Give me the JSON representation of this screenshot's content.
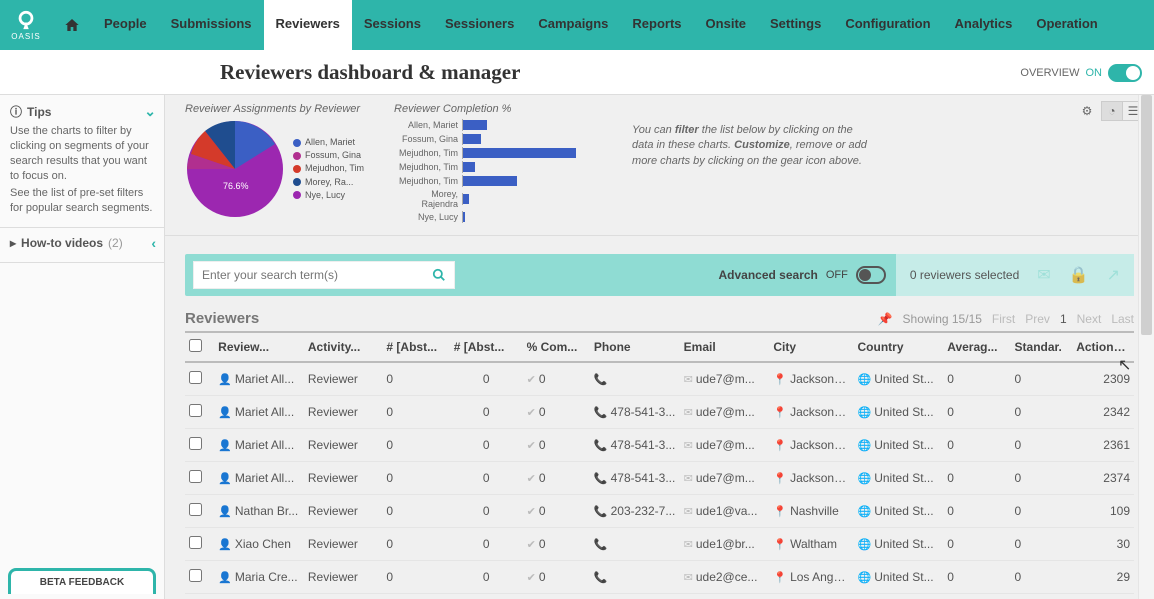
{
  "brand": "OASIS",
  "nav": [
    "People",
    "Submissions",
    "Reviewers",
    "Sessions",
    "Sessioners",
    "Campaigns",
    "Reports",
    "Onsite",
    "Settings",
    "Configuration",
    "Analytics",
    "Operation"
  ],
  "nav_active": "Reviewers",
  "page_title": "Reviewers dashboard & manager",
  "overview": {
    "label": "OVERVIEW",
    "state": "ON"
  },
  "tips": {
    "title": "Tips",
    "body1": "Use the charts to filter by clicking on segments of your search results that you want to focus on.",
    "body2": "See the list of pre-set filters for popular search segments."
  },
  "howto": {
    "title": "How-to videos",
    "count": "(2)"
  },
  "beta": "BETA FEEDBACK",
  "chart1_title": "Reveiwer Assignments by Reviewer",
  "chart2_title": "Reviewer Completion %",
  "chart_hint": "You can <b>filter</b> the list below by clicking on the data in these charts. <b>Customize</b>, remove or add more charts by clicking on the gear icon above.",
  "pie_pct": "76.6%",
  "legend": [
    {
      "label": "Allen, Mariet",
      "color": "#3b5fc4"
    },
    {
      "label": "Fossum, Gina",
      "color": "#b12f8f"
    },
    {
      "label": "Mejudhon, Tim",
      "color": "#d43a2a"
    },
    {
      "label": "Morey, Ra...",
      "color": "#1f4d8f"
    },
    {
      "label": "Nye, Lucy",
      "color": "#9c27b0"
    }
  ],
  "bars": [
    {
      "label": "Allen, Mariet",
      "v": 0.2
    },
    {
      "label": "Fossum, Gina",
      "v": 0.15
    },
    {
      "label": "Mejudhon, Tim",
      "v": 0.95
    },
    {
      "label": "Mejudhon, Tim",
      "v": 0.1
    },
    {
      "label": "Mejudhon, Tim",
      "v": 0.45
    },
    {
      "label": "Morey, Rajendra",
      "v": 0.05
    },
    {
      "label": "Nye, Lucy",
      "v": 0.02
    }
  ],
  "chart_data": [
    {
      "type": "pie",
      "title": "Reveiwer Assignments by Reviewer",
      "series": [
        {
          "name": "Nye, Lucy",
          "value": 76.6,
          "color": "#9c27b0"
        },
        {
          "name": "Mejudhon, Tim",
          "value": 10,
          "color": "#d43a2a"
        },
        {
          "name": "Morey, Ra...",
          "value": 6,
          "color": "#1f4d8f"
        },
        {
          "name": "Allen, Mariet",
          "value": 5,
          "color": "#3b5fc4"
        },
        {
          "name": "Fossum, Gina",
          "value": 2.4,
          "color": "#b12f8f"
        }
      ]
    },
    {
      "type": "bar",
      "title": "Reviewer Completion %",
      "orientation": "horizontal",
      "xlim": [
        0,
        100
      ],
      "categories": [
        "Allen, Mariet",
        "Fossum, Gina",
        "Mejudhon, Tim",
        "Mejudhon, Tim",
        "Mejudhon, Tim",
        "Morey, Rajendra",
        "Nye, Lucy"
      ],
      "values": [
        20,
        15,
        95,
        10,
        45,
        5,
        2
      ]
    }
  ],
  "search_placeholder": "Enter your search term(s)",
  "adv_label": "Advanced search",
  "adv_state": "OFF",
  "selected_text": "0 reviewers selected",
  "grid_title": "Reviewers",
  "showing": "Showing 15/15",
  "pager": {
    "first": "First",
    "prev": "Prev",
    "cur": "1",
    "next": "Next",
    "last": "Last"
  },
  "columns": [
    "",
    "Review...",
    "Activity...",
    "# [Abst...",
    "# [Abst...",
    "% Com...",
    "Phone",
    "Email",
    "City",
    "Country",
    "Averag...",
    "Standar.",
    "Actions ⚙"
  ],
  "rows": [
    {
      "rev": "Mariet All...",
      "act": "Reviewer",
      "n1": "0",
      "n2": "0",
      "pc": "0",
      "ph": "",
      "em": "ude7@m...",
      "ci": "Jacksonvil...",
      "co": "United St...",
      "av": "0",
      "st": "0",
      "ac": "2309"
    },
    {
      "rev": "Mariet All...",
      "act": "Reviewer",
      "n1": "0",
      "n2": "0",
      "pc": "0",
      "ph": "478-541-3...",
      "em": "ude7@m...",
      "ci": "Jacksonvil...",
      "co": "United St...",
      "av": "0",
      "st": "0",
      "ac": "2342"
    },
    {
      "rev": "Mariet All...",
      "act": "Reviewer",
      "n1": "0",
      "n2": "0",
      "pc": "0",
      "ph": "478-541-3...",
      "em": "ude7@m...",
      "ci": "Jacksonvil...",
      "co": "United St...",
      "av": "0",
      "st": "0",
      "ac": "2361"
    },
    {
      "rev": "Mariet All...",
      "act": "Reviewer",
      "n1": "0",
      "n2": "0",
      "pc": "0",
      "ph": "478-541-3...",
      "em": "ude7@m...",
      "ci": "Jacksonvil...",
      "co": "United St...",
      "av": "0",
      "st": "0",
      "ac": "2374"
    },
    {
      "rev": "Nathan Br...",
      "act": "Reviewer",
      "n1": "0",
      "n2": "0",
      "pc": "0",
      "ph": "203-232-7...",
      "em": "ude1@va...",
      "ci": "Nashville",
      "co": "United St...",
      "av": "0",
      "st": "0",
      "ac": "109"
    },
    {
      "rev": "Xiao Chen",
      "act": "Reviewer",
      "n1": "0",
      "n2": "0",
      "pc": "0",
      "ph": "",
      "em": "ude1@br...",
      "ci": "Waltham",
      "co": "United St...",
      "av": "0",
      "st": "0",
      "ac": "30"
    },
    {
      "rev": "Maria Cre...",
      "act": "Reviewer",
      "n1": "0",
      "n2": "0",
      "pc": "0",
      "ph": "",
      "em": "ude2@ce...",
      "ci": "Los Angeles",
      "co": "United St...",
      "av": "0",
      "st": "0",
      "ac": "29"
    }
  ]
}
